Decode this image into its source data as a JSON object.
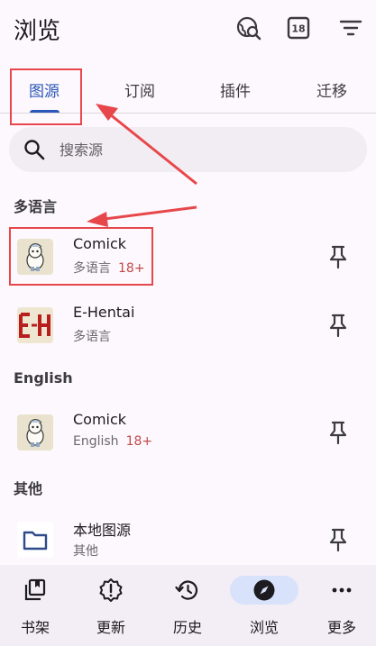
{
  "header": {
    "title": "浏览",
    "icons": [
      "globe-search-icon",
      "nsfw-18-icon",
      "filter-icon"
    ],
    "badge_text": "18"
  },
  "tabs": [
    {
      "label": "图源",
      "active": true
    },
    {
      "label": "订阅",
      "active": false
    },
    {
      "label": "插件",
      "active": false
    },
    {
      "label": "迁移",
      "active": false
    }
  ],
  "search": {
    "placeholder": "搜索源"
  },
  "sections": [
    {
      "title": "多语言",
      "items": [
        {
          "name": "Comick",
          "sub": "多语言",
          "badge": "18+",
          "icon": "comick-icon"
        },
        {
          "name": "E-Hentai",
          "sub": "多语言",
          "badge": "",
          "icon": "ehentai-icon"
        }
      ]
    },
    {
      "title": "English",
      "items": [
        {
          "name": "Comick",
          "sub": "English",
          "badge": "18+",
          "icon": "comick-icon"
        }
      ]
    },
    {
      "title": "其他",
      "items": [
        {
          "name": "本地图源",
          "sub": "其他",
          "badge": "",
          "icon": "folder-icon"
        }
      ]
    }
  ],
  "bottom_nav": [
    {
      "label": "书架",
      "icon": "library-icon",
      "active": false
    },
    {
      "label": "更新",
      "icon": "updates-icon",
      "active": false
    },
    {
      "label": "历史",
      "icon": "history-icon",
      "active": false
    },
    {
      "label": "浏览",
      "icon": "compass-icon",
      "active": true
    },
    {
      "label": "更多",
      "icon": "more-icon",
      "active": false
    }
  ],
  "colors": {
    "accent": "#2a57b8",
    "annotation": "#e7474b",
    "badge": "#c14a4a",
    "background": "#fdf8fd"
  }
}
